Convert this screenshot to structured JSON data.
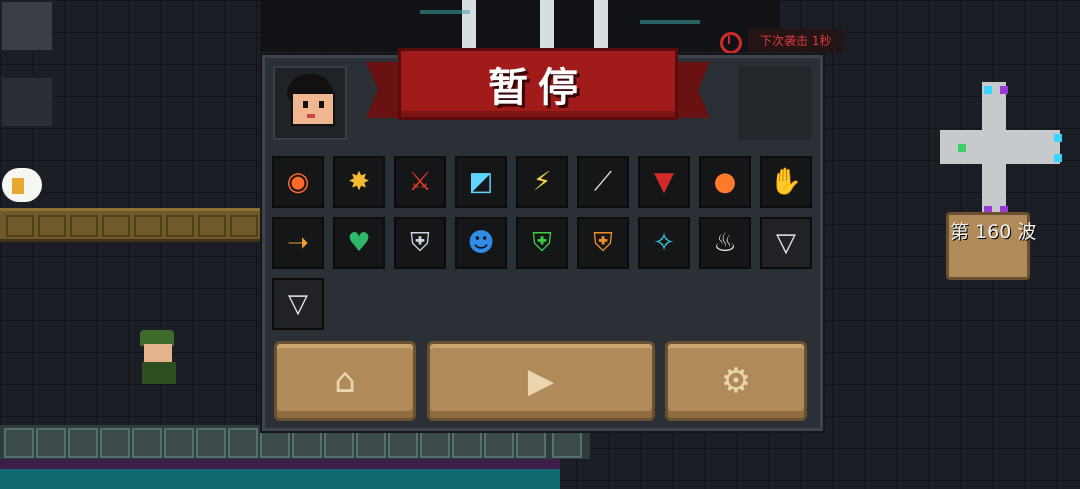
{
  "hud": {
    "next_attack": "下次袭击 1秒",
    "wave_label": "第 160 波"
  },
  "pause_menu": {
    "title": "暂停",
    "buffs_row1": [
      "fire-ring-buff",
      "explosion-buff",
      "red-sword-buff",
      "ice-blade-buff",
      "lightning-buff",
      "claw-slash-buff",
      "bat-buff",
      "fire-skull-buff",
      "purple-hand-buff"
    ],
    "buffs_row2": [
      "laser-shot-buff",
      "green-heart-buff",
      "silver-shield-buff",
      "blue-head-buff",
      "green-shield-buff",
      "orange-shield-buff",
      "sparkle-buff",
      "drink-cup-buff",
      "empty-cup-buff"
    ],
    "buffs_row3": [
      "empty-cup-buff"
    ],
    "buttons": [
      "home",
      "resume",
      "settings"
    ]
  },
  "colors": {
    "banner_red": "#a11b1b",
    "button_tan": "#b08b59",
    "panel": "#2b2f36",
    "alarm_red": "#e03a3a",
    "minimap_gray": "#c7cacc"
  }
}
